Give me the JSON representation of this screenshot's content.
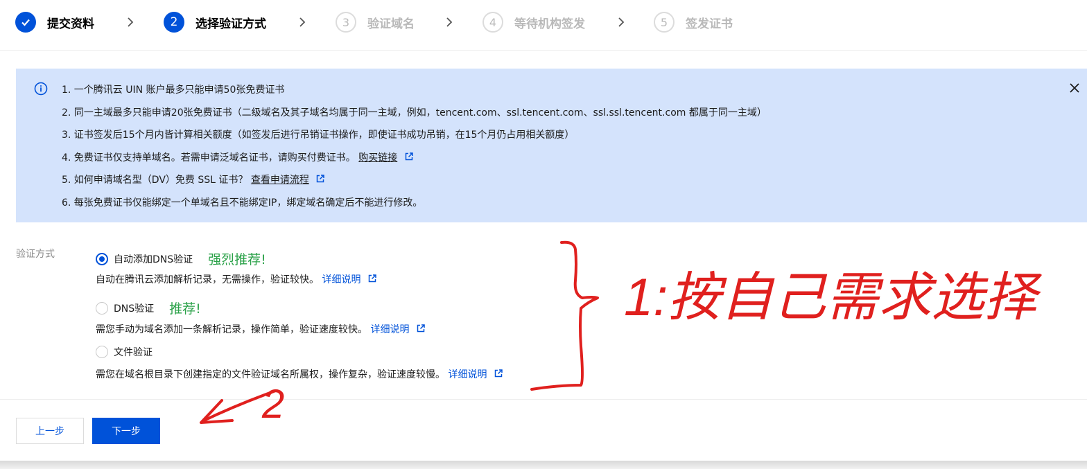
{
  "steps": [
    {
      "num": "",
      "label": "提交资料",
      "state": "done"
    },
    {
      "num": "2",
      "label": "选择验证方式",
      "state": "active"
    },
    {
      "num": "3",
      "label": "验证域名",
      "state": "todo"
    },
    {
      "num": "4",
      "label": "等待机构签发",
      "state": "todo"
    },
    {
      "num": "5",
      "label": "签发证书",
      "state": "todo"
    }
  ],
  "alert": {
    "lines": [
      "1. 一个腾讯云 UIN 账户最多只能申请50张免费证书",
      "2. 同一主域最多只能申请20张免费证书（二级域名及其子域名均属于同一主域，例如，tencent.com、ssl.tencent.com、ssl.ssl.tencent.com 都属于同一主域）",
      "3. 证书签发后15个月内皆计算相关额度（如签发后进行吊销证书操作，即使证书成功吊销，在15个月仍占用相关额度）",
      "4. 免费证书仅支持单域名。若需申请泛域名证书，请购买付费证书。",
      "5. 如何申请域名型（DV）免费 SSL 证书？",
      "6. 每张免费证书仅能绑定一个单域名且不能绑定IP，绑定域名确定后不能进行修改。"
    ],
    "link4": "购买链接",
    "link5": "查看申请流程"
  },
  "form": {
    "label": "验证方式",
    "options": [
      {
        "label": "自动添加DNS验证",
        "recommend": "强烈推荐!",
        "desc": "自动在腾讯云添加解析记录，无需操作，验证较快。",
        "link": "详细说明",
        "checked": true
      },
      {
        "label": "DNS验证",
        "recommend": "推荐!",
        "desc": "需您手动为域名添加一条解析记录，操作简单，验证速度较快。",
        "link": "详细说明",
        "checked": false
      },
      {
        "label": "文件验证",
        "recommend": "",
        "desc": "需您在域名根目录下创建指定的文件验证域名所属权，操作复杂，验证速度较慢。",
        "link": "详细说明",
        "checked": false
      }
    ]
  },
  "buttons": {
    "prev": "上一步",
    "next": "下一步"
  },
  "annotation": {
    "text": "1:按自己需求选择",
    "arrow_label": "2",
    "color": "#e0201e"
  },
  "colors": {
    "primary": "#0052d9",
    "alert_bg": "#d4e3fc",
    "recommend": "#2aa148"
  }
}
